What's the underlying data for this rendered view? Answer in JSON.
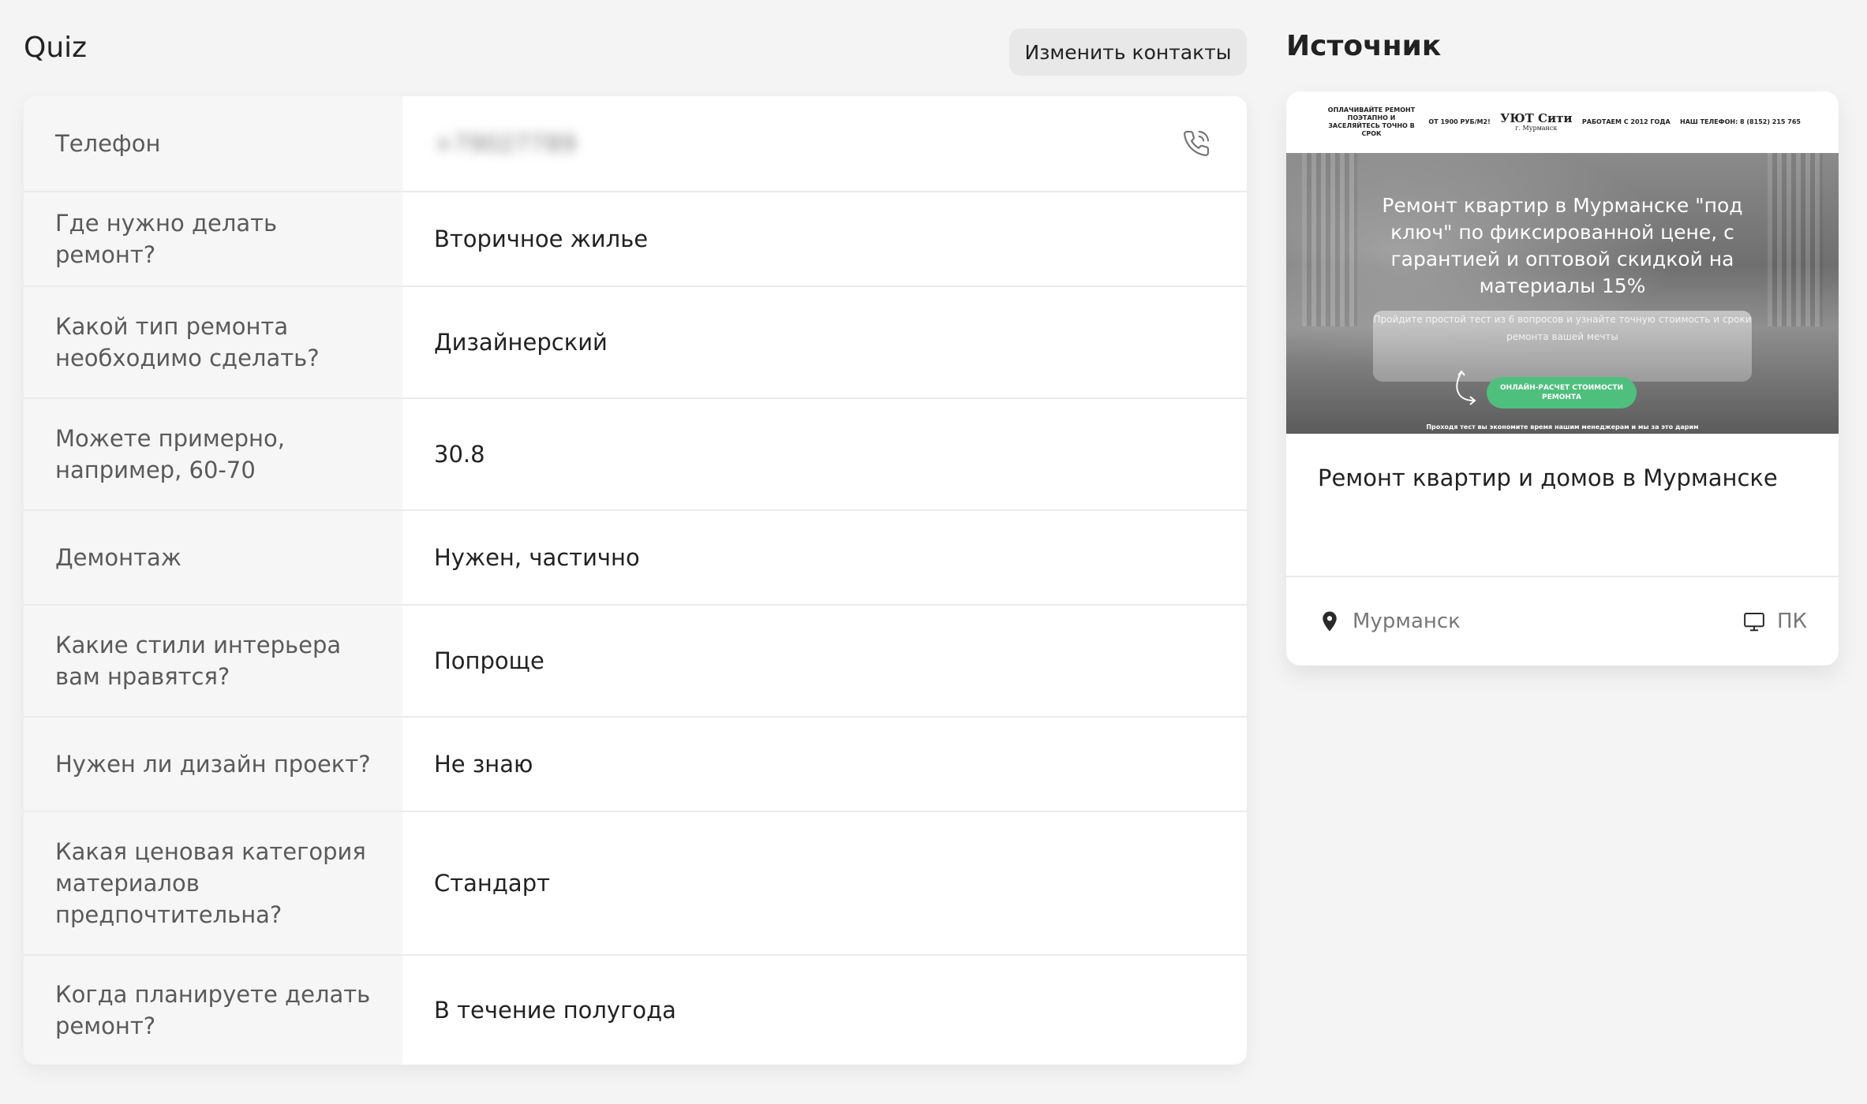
{
  "quiz": {
    "title": "Quiz",
    "edit_contacts_label": "Изменить контакты",
    "rows": [
      {
        "question": "Телефон",
        "answer": "+79027789"
      },
      {
        "question": "Где нужно делать ремонт?",
        "answer": "Вторичное жилье"
      },
      {
        "question": "Какой тип ремонта необходимо сделать?",
        "answer": "Дизайнерский"
      },
      {
        "question": "Можете примерно, например, 60-70",
        "answer": "30.8"
      },
      {
        "question": "Демонтаж",
        "answer": "Нужен, частично"
      },
      {
        "question": "Какие стили интерьера вам нравятся?",
        "answer": "Попроще"
      },
      {
        "question": "Нужен ли дизайн проект?",
        "answer": "Не знаю"
      },
      {
        "question": "Какая ценовая категория материалов предпочтительна?",
        "answer": "Стандарт"
      },
      {
        "question": "Когда планируете делать ремонт?",
        "answer": "В течение полугода"
      }
    ]
  },
  "source": {
    "title": "Источник",
    "preview": {
      "top_left": "ОПЛАЧИВАЙТЕ РЕМОНТ ПОЭТАПНО И ЗАСЕЛЯЙТЕСЬ ТОЧНО В СРОК",
      "top_price": "ОТ 1900 РУБ/М2!",
      "brand": "УЮТ Сити",
      "brand_city": "г. Мурманск",
      "top_years": "РАБОТАЕМ С 2012 ГОДА",
      "top_phone": "НАШ ТЕЛЕФОН: 8 (8152) 215 765",
      "headline": "Ремонт квартир в Мурманске \"под ключ\" по фиксированной цене, с гарантией и оптовой скидкой на материалы 15%",
      "subline": "Пройдите простой тест из 6 вопросов и узнайте точную стоимость и сроки ремонта вашей мечты",
      "cta": "ОНЛАЙН-РАСЧЕТ СТОИМОСТИ РЕМОНТА",
      "bottom_note": "Проходя тест вы экономите время нашим менеджерам и мы за это дарим"
    },
    "name": "Ремонт квартир и домов в Мурманске",
    "city": "Мурманск",
    "device": "ПК"
  }
}
